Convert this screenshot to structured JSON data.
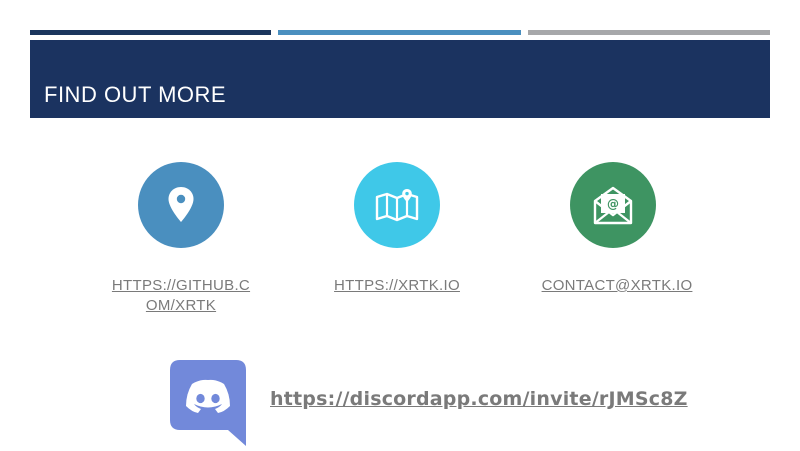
{
  "colors": {
    "bar1": "#1b365d",
    "bar2": "#4a8fbf",
    "bar3": "#a7a8aa",
    "header_bg": "#1b3360",
    "location_circle": "#4a8fbf",
    "map_circle": "#3fc8e8",
    "mail_circle": "#3e9462",
    "link_text": "#7a7a7a",
    "discord_brand": "#7289da"
  },
  "header": {
    "title": "FIND OUT MORE"
  },
  "links": [
    {
      "icon": "location-pin-icon",
      "text": "HTTPS://GITHUB.COM/XRTK"
    },
    {
      "icon": "map-icon",
      "text": "HTTPS://XRTK.IO"
    },
    {
      "icon": "email-icon",
      "text": "CONTACT@XRTK.IO"
    }
  ],
  "discord": {
    "icon": "discord-logo-icon",
    "url": "https://discordapp.com/invite/rJMSc8Z"
  }
}
